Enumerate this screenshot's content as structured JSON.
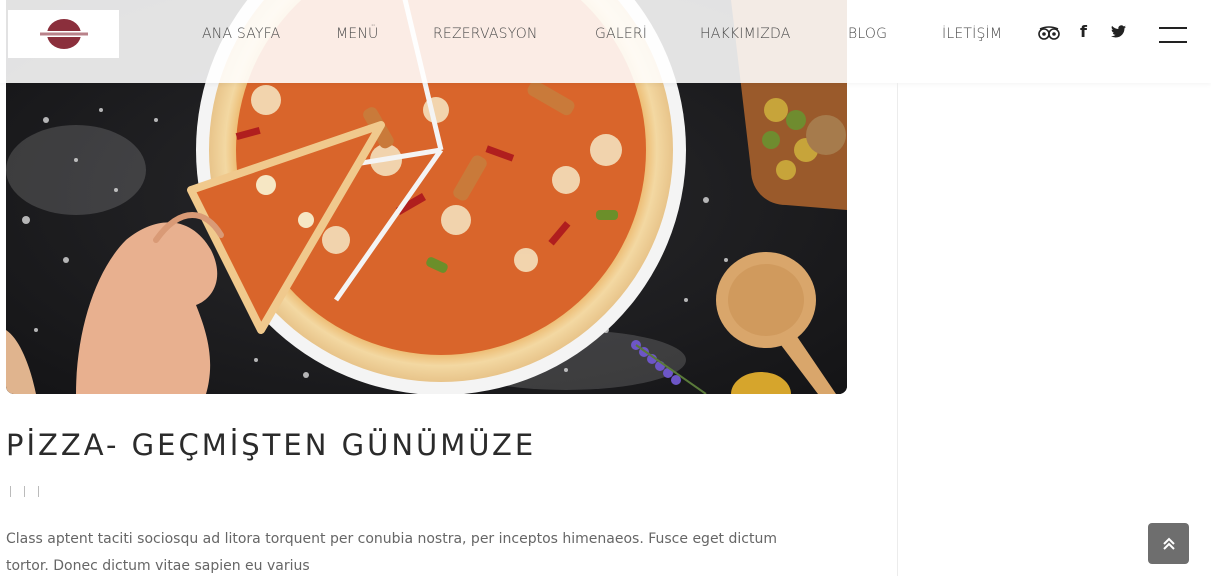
{
  "header": {
    "nav": [
      "ANA SAYFA",
      "MENÜ",
      "REZERVASYON",
      "GALERİ",
      "HAKKIMIZDA",
      "BLOG",
      "İLETİŞİM"
    ],
    "social": {
      "tripadvisor": "tripadvisor-icon",
      "facebook": "f",
      "twitter": "twitter-icon"
    },
    "menu_icon": "hamburger-icon"
  },
  "post": {
    "title": "PİZZA- GEÇMİŞTEN GÜNÜMÜZE",
    "excerpt": "Class aptent taciti sociosqu ad litora torquent per conubia nostra, per inceptos himenaeos. Fusce eget dictum tortor. Donec dictum vitae sapien eu varius"
  },
  "colors": {
    "logo": "#8b2f3c",
    "to_top_bg": "#6e6e6e"
  }
}
